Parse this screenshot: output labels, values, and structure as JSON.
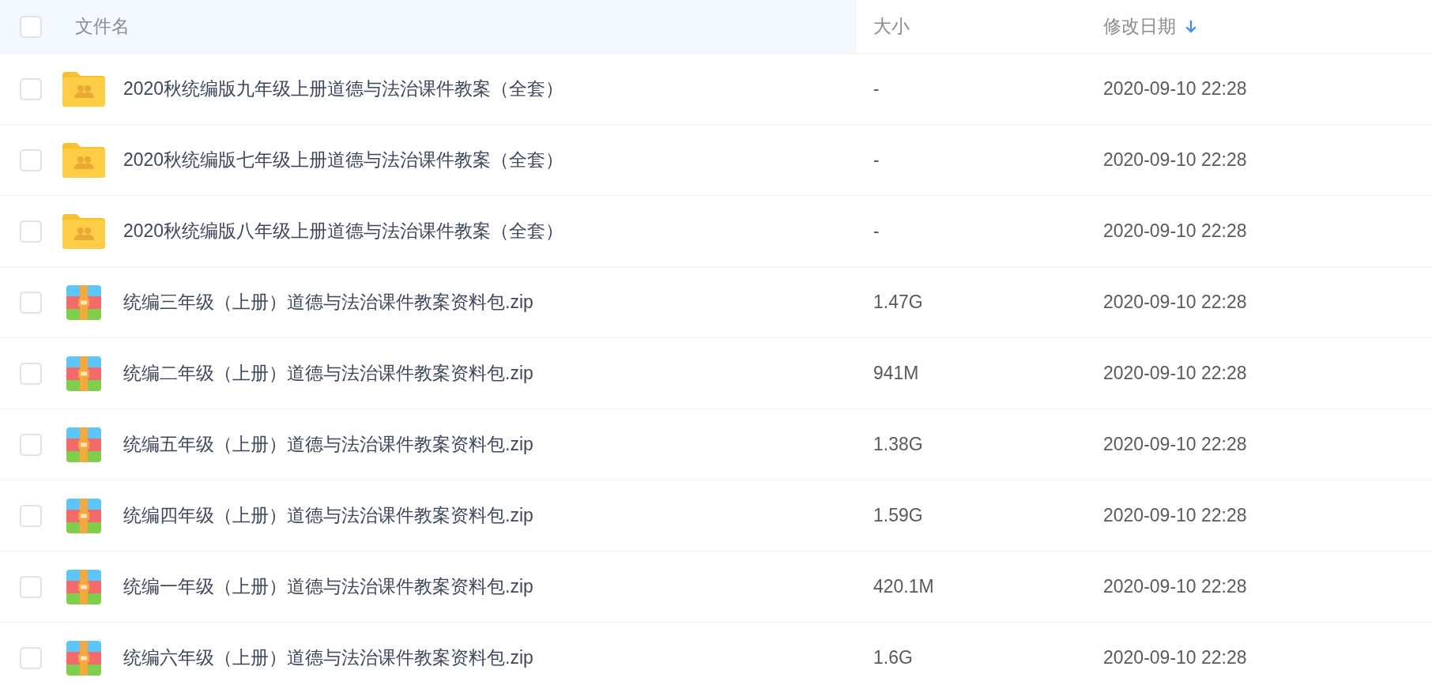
{
  "table": {
    "select_all": {
      "checked": false
    },
    "columns": [
      {
        "label": "文件名",
        "highlighted": true,
        "sorted": false
      },
      {
        "label": "大小",
        "highlighted": false,
        "sorted": false
      },
      {
        "label": "修改日期",
        "highlighted": false,
        "sorted": true
      }
    ],
    "rows": [
      {
        "kind": "folder",
        "checked": false,
        "name": "2020秋统编版九年级上册道德与法治课件教案（全套）",
        "size": "-",
        "modified": "2020-09-10 22:28"
      },
      {
        "kind": "folder",
        "checked": false,
        "name": "2020秋统编版七年级上册道德与法治课件教案（全套）",
        "size": "-",
        "modified": "2020-09-10 22:28"
      },
      {
        "kind": "folder",
        "checked": false,
        "name": "2020秋统编版八年级上册道德与法治课件教案（全套）",
        "size": "-",
        "modified": "2020-09-10 22:28"
      },
      {
        "kind": "archive",
        "checked": false,
        "name": "统编三年级（上册）道德与法治课件教案资料包.zip",
        "size": "1.47G",
        "modified": "2020-09-10 22:28"
      },
      {
        "kind": "archive",
        "checked": false,
        "name": "统编二年级（上册）道德与法治课件教案资料包.zip",
        "size": "941M",
        "modified": "2020-09-10 22:28"
      },
      {
        "kind": "archive",
        "checked": false,
        "name": "统编五年级（上册）道德与法治课件教案资料包.zip",
        "size": "1.38G",
        "modified": "2020-09-10 22:28"
      },
      {
        "kind": "archive",
        "checked": false,
        "name": "统编四年级（上册）道德与法治课件教案资料包.zip",
        "size": "1.59G",
        "modified": "2020-09-10 22:28"
      },
      {
        "kind": "archive",
        "checked": false,
        "name": "统编一年级（上册）道德与法治课件教案资料包.zip",
        "size": "420.1M",
        "modified": "2020-09-10 22:28"
      },
      {
        "kind": "archive",
        "checked": false,
        "name": "统编六年级（上册）道德与法治课件教案资料包.zip",
        "size": "1.6G",
        "modified": "2020-09-10 22:28"
      }
    ]
  }
}
